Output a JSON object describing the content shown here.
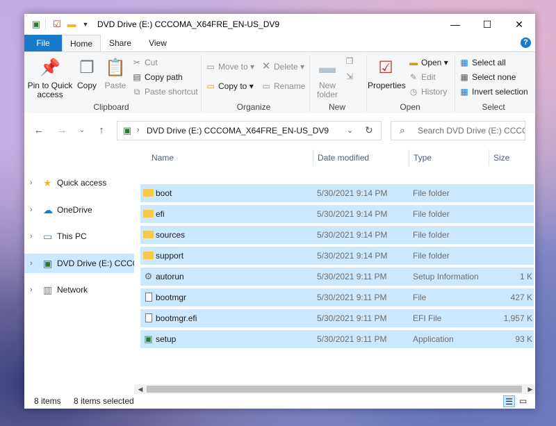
{
  "window": {
    "title": "DVD Drive (E:) CCCOMA_X64FRE_EN-US_DV9",
    "minimize_glyph": "—",
    "maximize_glyph": "☐",
    "close_glyph": "✕"
  },
  "tabs": [
    "File",
    "Home",
    "Share",
    "View"
  ],
  "ribbon": {
    "clipboard": {
      "label": "Clipboard",
      "pin": "Pin to Quick access",
      "copy": "Copy",
      "paste": "Paste",
      "cut": "Cut",
      "copy_path": "Copy path",
      "paste_shortcut": "Paste shortcut"
    },
    "organize": {
      "label": "Organize",
      "move_to": "Move to",
      "copy_to": "Copy to",
      "delete": "Delete",
      "rename": "Rename"
    },
    "new": {
      "label": "New",
      "new_folder": "New folder"
    },
    "open": {
      "label": "Open",
      "properties": "Properties",
      "open": "Open",
      "edit": "Edit",
      "history": "History"
    },
    "select": {
      "label": "Select",
      "select_all": "Select all",
      "select_none": "Select none",
      "invert": "Invert selection"
    }
  },
  "address": {
    "path": "DVD Drive (E:) CCCOMA_X64FRE_EN-US_DV9",
    "search_placeholder": "Search DVD Drive (E:) CCCO..."
  },
  "nav_pane": [
    {
      "label": "Quick access",
      "icon": "star-icon"
    },
    {
      "label": "OneDrive",
      "icon": "cloud-icon"
    },
    {
      "label": "This PC",
      "icon": "monitor-icon"
    },
    {
      "label": "DVD Drive (E:) CCCO",
      "icon": "dvd-drive-icon"
    },
    {
      "label": "Network",
      "icon": "network-icon"
    }
  ],
  "columns": {
    "name": "Name",
    "date": "Date modified",
    "type": "Type",
    "size": "Size"
  },
  "files": [
    {
      "name": "boot",
      "date": "5/30/2021 9:14 PM",
      "type": "File folder",
      "size": "",
      "icon": "folder-icon"
    },
    {
      "name": "efi",
      "date": "5/30/2021 9:14 PM",
      "type": "File folder",
      "size": "",
      "icon": "folder-icon"
    },
    {
      "name": "sources",
      "date": "5/30/2021 9:14 PM",
      "type": "File folder",
      "size": "",
      "icon": "folder-icon"
    },
    {
      "name": "support",
      "date": "5/30/2021 9:14 PM",
      "type": "File folder",
      "size": "",
      "icon": "folder-icon"
    },
    {
      "name": "autorun",
      "date": "5/30/2021 9:11 PM",
      "type": "Setup Information",
      "size": "1 K",
      "icon": "setup-info-icon"
    },
    {
      "name": "bootmgr",
      "date": "5/30/2021 9:11 PM",
      "type": "File",
      "size": "427 K",
      "icon": "file-icon"
    },
    {
      "name": "bootmgr.efi",
      "date": "5/30/2021 9:11 PM",
      "type": "EFI File",
      "size": "1,957 K",
      "icon": "file-icon"
    },
    {
      "name": "setup",
      "date": "5/30/2021 9:11 PM",
      "type": "Application",
      "size": "93 K",
      "icon": "setup-app-icon"
    }
  ],
  "status": {
    "items": "8 items",
    "selected": "8 items selected"
  },
  "colors": {
    "accent": "#1979ca",
    "selection": "#cce8ff",
    "folder": "#f7c948"
  }
}
